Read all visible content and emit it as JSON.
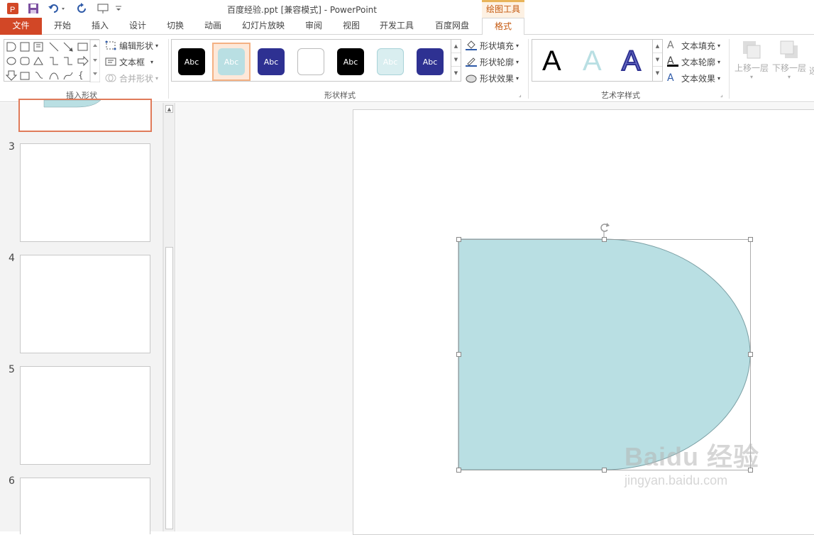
{
  "window": {
    "title": "百度经验.ppt [兼容模式] - PowerPoint",
    "context_tab_group": "绘图工具"
  },
  "tabs": [
    {
      "label": "文件"
    },
    {
      "label": "开始"
    },
    {
      "label": "插入"
    },
    {
      "label": "设计"
    },
    {
      "label": "切换"
    },
    {
      "label": "动画"
    },
    {
      "label": "幻灯片放映"
    },
    {
      "label": "审阅"
    },
    {
      "label": "视图"
    },
    {
      "label": "开发工具"
    },
    {
      "label": "百度网盘"
    },
    {
      "label": "格式"
    }
  ],
  "active_tab": "格式",
  "ribbon": {
    "insert_shapes": {
      "label": "插入形状",
      "edit_shape": "编辑形状",
      "text_box": "文本框",
      "merge_shapes": "合并形状"
    },
    "shape_styles": {
      "label": "形状样式",
      "swatch_text": "Abc",
      "swatches": [
        {
          "fill": "#000000",
          "text": "#ffffff",
          "selected": false
        },
        {
          "fill": "#b9dfe3",
          "text": "#ffffff",
          "selected": true
        },
        {
          "fill": "#2e3192",
          "text": "#ffffff",
          "selected": false
        },
        {
          "fill": "#ffffff",
          "text": "#ffffff",
          "selected": false
        },
        {
          "fill": "#000000",
          "text": "#ffffff",
          "selected": false
        },
        {
          "fill": "#d9eef0",
          "text": "#ffffff",
          "selected": false
        },
        {
          "fill": "#2e3192",
          "text": "#ffffff",
          "selected": false
        }
      ],
      "shape_fill": "形状填充",
      "shape_outline": "形状轮廓",
      "shape_effects": "形状效果"
    },
    "wordart_styles": {
      "label": "艺术字样式",
      "letter": "A",
      "text_fill": "文本填充",
      "text_outline": "文本轮廓",
      "text_effects": "文本效果"
    },
    "arrange": {
      "bring_forward": "上移一层",
      "send_backward": "下移一层",
      "truncated": "选"
    }
  },
  "slide_panel": {
    "slide_numbers": [
      "3",
      "4",
      "5",
      "6"
    ]
  },
  "shape": {
    "fill": "#b9dfe3",
    "outline": "#7a9ea3"
  },
  "watermark": {
    "line1": "Baidu 经验",
    "line2": "jingyan.baidu.com"
  }
}
